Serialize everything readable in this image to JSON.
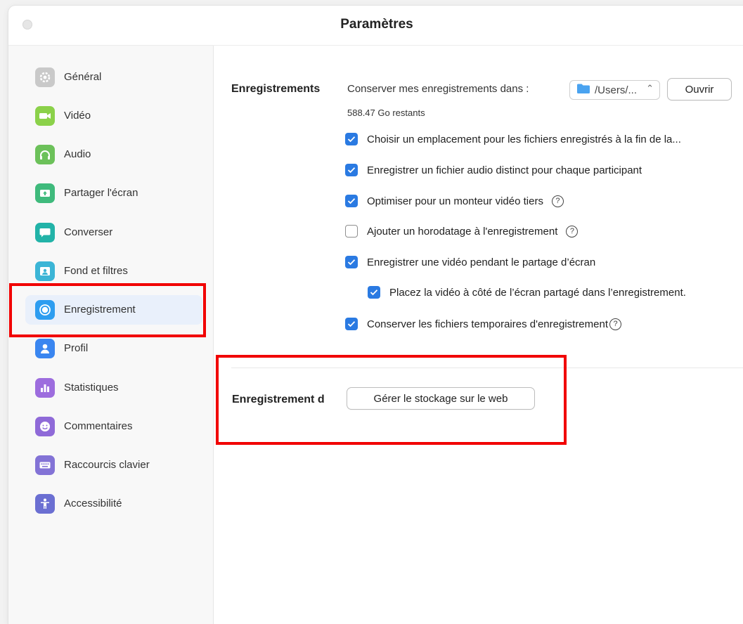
{
  "window": {
    "title": "Paramètres"
  },
  "sidebar": {
    "items": [
      {
        "label": "Général",
        "icon": "gear-icon",
        "color": "#c9c9c9"
      },
      {
        "label": "Vidéo",
        "icon": "video-camera-icon",
        "color": "#8bd14a"
      },
      {
        "label": "Audio",
        "icon": "headphones-icon",
        "color": "#6cc15a"
      },
      {
        "label": "Partager l'écran",
        "icon": "share-screen-icon",
        "color": "#3fba7c"
      },
      {
        "label": "Converser",
        "icon": "chat-bubble-icon",
        "color": "#22b3a8"
      },
      {
        "label": "Fond et filtres",
        "icon": "portrait-icon",
        "color": "#3cb5d6"
      },
      {
        "label": "Enregistrement",
        "icon": "record-icon",
        "color": "#2d9df0"
      },
      {
        "label": "Profil",
        "icon": "person-icon",
        "color": "#3a86f0"
      },
      {
        "label": "Statistiques",
        "icon": "bar-chart-icon",
        "color": "#9d6dde"
      },
      {
        "label": "Commentaires",
        "icon": "smiley-icon",
        "color": "#8f6ad8"
      },
      {
        "label": "Raccourcis clavier",
        "icon": "keyboard-icon",
        "color": "#8373d6"
      },
      {
        "label": "Accessibilité",
        "icon": "accessibility-icon",
        "color": "#6b6fd2"
      }
    ],
    "active_index": 6
  },
  "recordings": {
    "section_label": "Enregistrements",
    "keep_label": "Conserver mes enregistrements dans :",
    "folder_value": "/Users/...",
    "open_button": "Ouvrir",
    "remaining": "588.47 Go restants",
    "options": [
      {
        "label": "Choisir un emplacement pour les fichiers enregistrés à la fin de la...",
        "checked": true,
        "help": false
      },
      {
        "label": "Enregistrer un fichier audio distinct pour chaque participant",
        "checked": true,
        "help": false
      },
      {
        "label": "Optimiser pour un monteur vidéo tiers",
        "checked": true,
        "help": true
      },
      {
        "label": "Ajouter un horodatage à l'enregistrement",
        "checked": false,
        "help": true
      },
      {
        "label": "Enregistrer une vidéo pendant le partage d’écran",
        "checked": true,
        "help": false
      },
      {
        "label": "Placez la vidéo à côté de l’écran partagé dans l’enregistrement.",
        "checked": true,
        "help": false
      },
      {
        "label": "Conserver les fichiers temporaires d'enregistrement",
        "checked": true,
        "help": true
      }
    ]
  },
  "cloud": {
    "section_label": "Enregistrement d",
    "manage_button": "Gérer le stockage sur le web"
  },
  "colors": {
    "accent": "#2a7ae2",
    "highlight": "#f10000",
    "folder": "#4aa3f0"
  }
}
